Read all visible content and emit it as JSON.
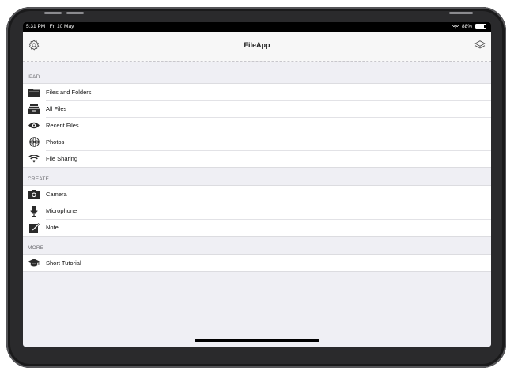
{
  "status_bar": {
    "time": "5:31 PM",
    "date": "Fri 10 May",
    "battery": "88%"
  },
  "navbar": {
    "title": "FileApp",
    "left_icon": "gear-icon",
    "right_icon": "layers-icon"
  },
  "sections": [
    {
      "header": "IPAD",
      "items": [
        {
          "label": "Files and Folders",
          "icon": "folder-icon"
        },
        {
          "label": "All Files",
          "icon": "files-stack-icon"
        },
        {
          "label": "Recent Files",
          "icon": "eye-icon"
        },
        {
          "label": "Photos",
          "icon": "photos-icon"
        },
        {
          "label": "File Sharing",
          "icon": "wifi-icon"
        }
      ]
    },
    {
      "header": "CREATE",
      "items": [
        {
          "label": "Camera",
          "icon": "camera-icon"
        },
        {
          "label": "Microphone",
          "icon": "microphone-icon"
        },
        {
          "label": "Note",
          "icon": "note-icon"
        }
      ]
    },
    {
      "header": "MORE",
      "items": [
        {
          "label": "Short Tutorial",
          "icon": "graduation-cap-icon"
        }
      ]
    }
  ]
}
